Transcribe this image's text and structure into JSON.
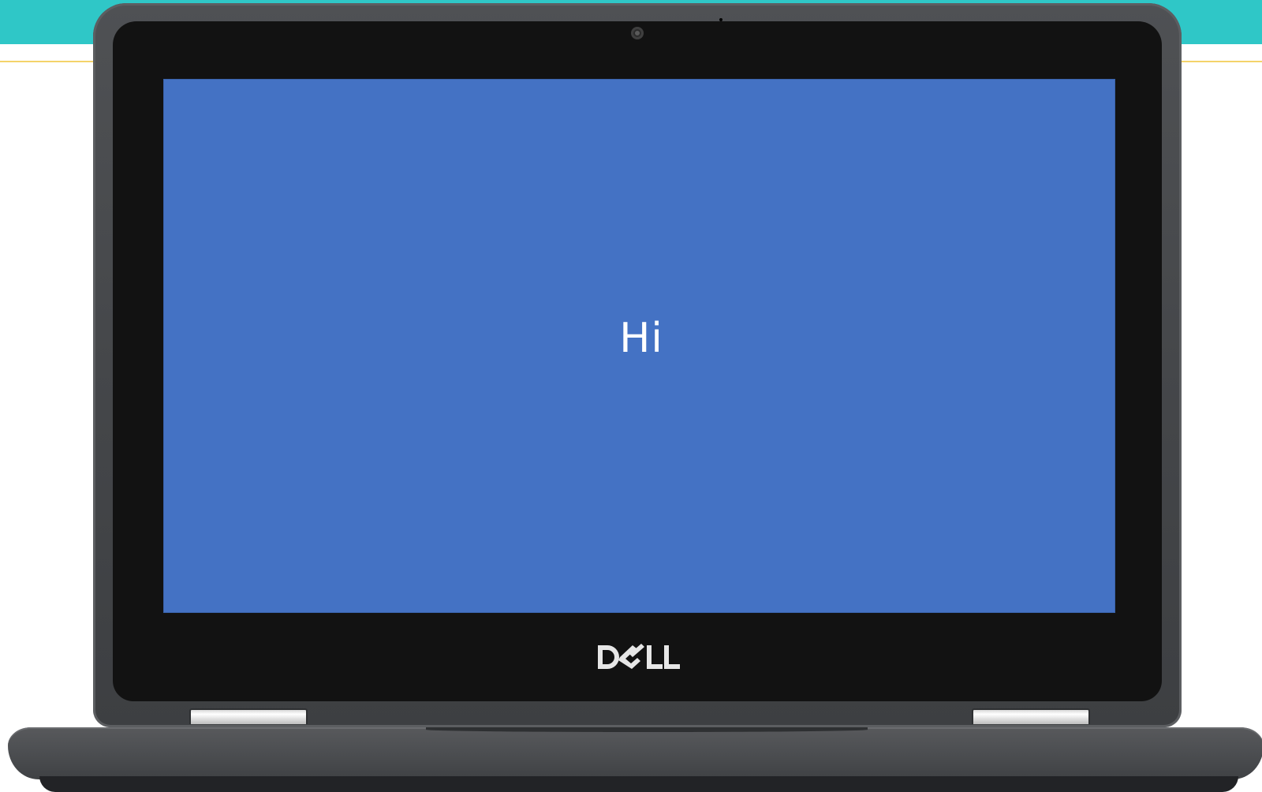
{
  "screen": {
    "text": "Hi",
    "background_color": "#4472c4",
    "text_color": "#ffffff"
  },
  "device": {
    "brand": "DELL",
    "icons": [
      "webcam-icon",
      "dell-logo"
    ]
  },
  "colors": {
    "banner": "#2fc7c7",
    "banner_rule": "#f4d36a",
    "bezel": "#121212",
    "chassis": "#4b4d50"
  }
}
